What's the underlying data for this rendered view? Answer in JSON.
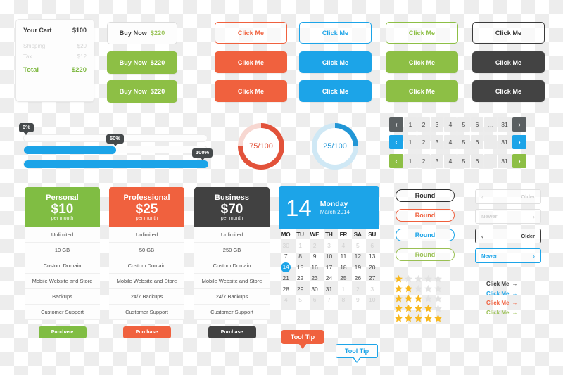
{
  "cart": {
    "title": "Your Cart",
    "total_top": "$100",
    "lines": [
      {
        "label": "Shipping",
        "value": "$20"
      },
      {
        "label": "Tax",
        "value": "$12"
      }
    ],
    "total_label": "Total",
    "total_value": "$220"
  },
  "buy_now": {
    "label": "Buy Now",
    "amount": "$220",
    "variants": [
      "outline",
      "solid-green",
      "solid-green"
    ]
  },
  "click_buttons": {
    "label": "Click Me",
    "columns": [
      {
        "name": "red",
        "color": "#f0613e"
      },
      {
        "name": "blue",
        "color": "#1ca4e8"
      },
      {
        "name": "green",
        "color": "#8dbf45"
      },
      {
        "name": "dark",
        "color": "#434343"
      }
    ],
    "rows": [
      "outline",
      "solid",
      "solid"
    ],
    "outline_dark_border": "#3b3b3b"
  },
  "progress_bars": [
    {
      "percent_label": "0%",
      "percent": 0
    },
    {
      "percent_label": "50%",
      "percent": 50
    },
    {
      "percent_label": "100%",
      "percent": 100
    }
  ],
  "donuts": [
    {
      "label": "75/100",
      "percent": 75,
      "color": "#e2523a",
      "track": "#f7d7d1"
    },
    {
      "label": "25/100",
      "percent": 25,
      "color": "#2196d6",
      "track": "#cfe8f5"
    }
  ],
  "pagination": {
    "pages": [
      "1",
      "2",
      "3",
      "4",
      "5",
      "6",
      "...",
      "31"
    ],
    "prev_icon": "chevron-left",
    "next_icon": "chevron-right",
    "rows": [
      {
        "name": "dark",
        "color": "#5a5f61"
      },
      {
        "name": "blue",
        "color": "#1ca4e8"
      },
      {
        "name": "green",
        "color": "#8dbf45"
      }
    ]
  },
  "pricing": [
    {
      "plan": "Personal",
      "price": "$10",
      "period": "per month",
      "color": "#80bd43",
      "features": [
        "Unlimited",
        "10 GB",
        "Custom Domain",
        "Mobile Website and Store",
        "Backups",
        "Customer Support"
      ],
      "cta": "Purchase"
    },
    {
      "plan": "Professional",
      "price": "$25",
      "period": "per month",
      "color": "#f0613e",
      "features": [
        "Unlimited",
        "50 GB",
        "Custom Domain",
        "Mobile Website and Store",
        "24/7 Backups",
        "Customer Support"
      ],
      "cta": "Purchase"
    },
    {
      "plan": "Business",
      "price": "$70",
      "period": "per month",
      "color": "#414141",
      "features": [
        "Unlimited",
        "250 GB",
        "Custom Domain",
        "Mobile Website and Store",
        "24/7 Backups",
        "Customer Support"
      ],
      "cta": "Purchase"
    }
  ],
  "calendar": {
    "day_number": "14",
    "weekday": "Monday",
    "month_year": "March 2014",
    "accent": "#1ca4e8",
    "weekdays": [
      "MO",
      "TU",
      "WE",
      "TH",
      "FR",
      "SA",
      "SU"
    ],
    "weeks": [
      [
        {
          "d": "30",
          "muted": true
        },
        {
          "d": "1",
          "muted": true
        },
        {
          "d": "2",
          "muted": true
        },
        {
          "d": "3",
          "muted": true
        },
        {
          "d": "4",
          "muted": true
        },
        {
          "d": "5",
          "muted": true
        },
        {
          "d": "6",
          "muted": true
        }
      ],
      [
        {
          "d": "7"
        },
        {
          "d": "8"
        },
        {
          "d": "9"
        },
        {
          "d": "10"
        },
        {
          "d": "11"
        },
        {
          "d": "12"
        },
        {
          "d": "13"
        }
      ],
      [
        {
          "d": "14",
          "today": true
        },
        {
          "d": "15"
        },
        {
          "d": "16"
        },
        {
          "d": "17"
        },
        {
          "d": "18"
        },
        {
          "d": "19"
        },
        {
          "d": "20"
        }
      ],
      [
        {
          "d": "21"
        },
        {
          "d": "22"
        },
        {
          "d": "23"
        },
        {
          "d": "24"
        },
        {
          "d": "25"
        },
        {
          "d": "26"
        },
        {
          "d": "27"
        }
      ],
      [
        {
          "d": "28"
        },
        {
          "d": "29"
        },
        {
          "d": "30"
        },
        {
          "d": "31"
        },
        {
          "d": "1",
          "muted": true
        },
        {
          "d": "2",
          "muted": true
        },
        {
          "d": "3",
          "muted": true
        }
      ],
      [
        {
          "d": "4",
          "muted": true
        },
        {
          "d": "5",
          "muted": true
        },
        {
          "d": "6",
          "muted": true
        },
        {
          "d": "7",
          "muted": true
        },
        {
          "d": "8",
          "muted": true
        },
        {
          "d": "9",
          "muted": true
        },
        {
          "d": "10",
          "muted": true
        }
      ]
    ]
  },
  "round_buttons": {
    "label": "Round",
    "variants": [
      {
        "name": "dark",
        "color": "#2f2f2f"
      },
      {
        "name": "red",
        "color": "#ef5f3c"
      },
      {
        "name": "blue",
        "color": "#1ca4e8"
      },
      {
        "name": "green",
        "color": "#9ac054"
      }
    ]
  },
  "nav_buttons": [
    {
      "direction": "older",
      "label": "Older",
      "icon": "chevron-left",
      "color": "#cfcfcf",
      "border": "#e0e0e0",
      "align": "right"
    },
    {
      "direction": "newer",
      "label": "Newer",
      "icon": "chevron-right",
      "color": "#cfcfcf",
      "border": "#e0e0e0",
      "align": "left"
    },
    {
      "direction": "older",
      "label": "Older",
      "icon": "chevron-left",
      "color": "#3b3b3b",
      "border": "#3b3b3b",
      "align": "right"
    },
    {
      "direction": "newer",
      "label": "Newer",
      "icon": "chevron-right",
      "color": "#1ca4e8",
      "border": "#1ca4e8",
      "align": "left"
    }
  ],
  "star_rating": {
    "max": 5,
    "filled_color": "#f8b81d",
    "empty_color": "#e2e2e2",
    "rows": [
      1,
      2,
      3,
      4,
      5
    ]
  },
  "link_buttons": [
    {
      "label": "Click Me",
      "icon": "arrow-right",
      "color": "#3b3b3b"
    },
    {
      "label": "Click Me",
      "icon": "arrow-right",
      "color": "#1ca4e8"
    },
    {
      "label": "Click Me",
      "icon": "arrow-right",
      "color": "#f0613e"
    },
    {
      "label": "Click Me",
      "icon": "arrow-right",
      "color": "#9ac054"
    }
  ],
  "tooltips": [
    {
      "label": "Tool Tip",
      "style": "solid",
      "color": "#f0613e"
    },
    {
      "label": "Tool Tip",
      "style": "outline",
      "color": "#1ca4e8"
    }
  ]
}
